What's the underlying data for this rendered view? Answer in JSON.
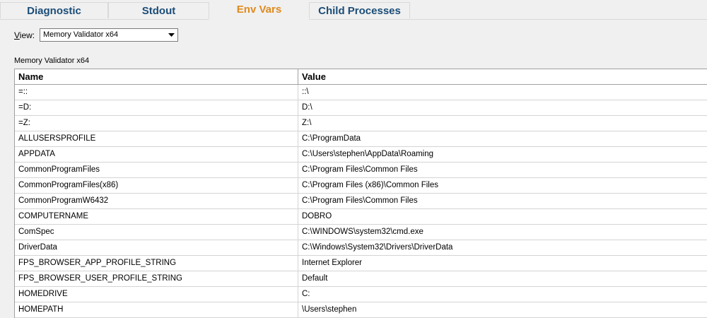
{
  "tabs": [
    {
      "label": "Diagnostic",
      "active": false
    },
    {
      "label": "Stdout",
      "active": false
    },
    {
      "label": "Env Vars",
      "active": true
    },
    {
      "label": "Child Processes",
      "active": false
    }
  ],
  "view": {
    "label_u": "V",
    "label_rest": "iew:",
    "selected": "Memory Validator x64"
  },
  "section_title": "Memory Validator x64",
  "table": {
    "columns": [
      "Name",
      "Value"
    ],
    "rows": [
      [
        "=::",
        "::\\"
      ],
      [
        "=D:",
        "D:\\"
      ],
      [
        "=Z:",
        "Z:\\"
      ],
      [
        "ALLUSERSPROFILE",
        "C:\\ProgramData"
      ],
      [
        "APPDATA",
        "C:\\Users\\stephen\\AppData\\Roaming"
      ],
      [
        "CommonProgramFiles",
        "C:\\Program Files\\Common Files"
      ],
      [
        "CommonProgramFiles(x86)",
        "C:\\Program Files (x86)\\Common Files"
      ],
      [
        "CommonProgramW6432",
        "C:\\Program Files\\Common Files"
      ],
      [
        "COMPUTERNAME",
        "DOBRO"
      ],
      [
        "ComSpec",
        "C:\\WINDOWS\\system32\\cmd.exe"
      ],
      [
        "DriverData",
        "C:\\Windows\\System32\\Drivers\\DriverData"
      ],
      [
        "FPS_BROWSER_APP_PROFILE_STRING",
        "Internet Explorer"
      ],
      [
        "FPS_BROWSER_USER_PROFILE_STRING",
        "Default"
      ],
      [
        "HOMEDRIVE",
        "C:"
      ],
      [
        "HOMEPATH",
        "\\Users\\stephen"
      ]
    ]
  },
  "colors": {
    "tab_text": "#1b4d78",
    "active_tab_text": "#e08a1e",
    "background": "#f0f0f0"
  }
}
